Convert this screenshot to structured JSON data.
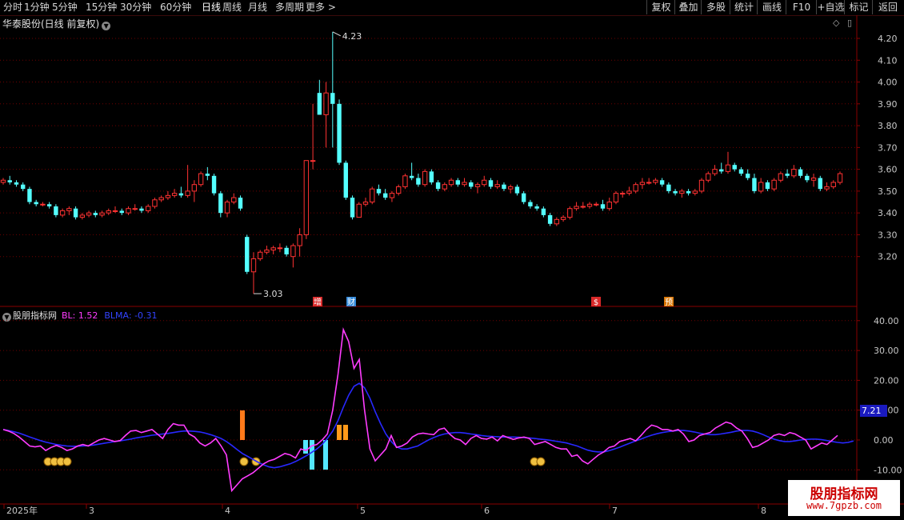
{
  "toolbar": {
    "periods": [
      "分时",
      "1分钟",
      "5分钟",
      "15分钟",
      "30分钟",
      "60分钟",
      "日线",
      "周线",
      "月线",
      "多周期",
      "更多 >"
    ],
    "active_period": "日线",
    "right_buttons": [
      "复权",
      "叠加",
      "多股",
      "统计",
      "画线",
      "F10",
      "+自选",
      "标记",
      "返回"
    ]
  },
  "stock_title": "华泰股份(日线 前复权)",
  "indicator": {
    "name": "股朋指标网",
    "bl_label": "BL: 1.52",
    "blma_label": "BLMA: -0.31"
  },
  "price_axis": [
    "4.20",
    "4.10",
    "4.00",
    "3.90",
    "3.80",
    "3.70",
    "3.60",
    "3.50",
    "3.40",
    "3.30",
    "3.20"
  ],
  "ind_axis": [
    "40.00",
    "30.00",
    "20.00",
    "10.00",
    "0.00",
    "-10.00"
  ],
  "ind_current_value": "7.21",
  "annotations": {
    "high": "4.23",
    "low": "3.03"
  },
  "event_markers": [
    {
      "label": "增",
      "color": "#ff3030"
    },
    {
      "label": "财",
      "color": "#3aa0ff"
    },
    {
      "label": "$",
      "color": "#ff3030"
    },
    {
      "label": "预",
      "color": "#ff8800"
    }
  ],
  "date_axis": [
    "2025年",
    "3",
    "4",
    "5",
    "6",
    "7",
    "8"
  ],
  "watermark": {
    "title": "股朋指标网",
    "url": "www.7gpzb.com"
  },
  "colors": {
    "up": "#ff3232",
    "down": "#54ffff",
    "bl": "#ff3cff",
    "blma": "#2828ff",
    "grid": "#6e0000",
    "axis": "#8a0000"
  },
  "chart_data": [
    {
      "type": "candlestick",
      "title": "华泰股份(日线 前复权)",
      "ylim": [
        3.03,
        4.23
      ],
      "series_note": "daily OHLC",
      "ohlc": [
        [
          3.54,
          3.56,
          3.53,
          3.55
        ],
        [
          3.55,
          3.57,
          3.53,
          3.54
        ],
        [
          3.54,
          3.55,
          3.52,
          3.53
        ],
        [
          3.53,
          3.54,
          3.5,
          3.51
        ],
        [
          3.51,
          3.52,
          3.44,
          3.45
        ],
        [
          3.45,
          3.46,
          3.43,
          3.44
        ],
        [
          3.44,
          3.45,
          3.43,
          3.44
        ],
        [
          3.44,
          3.45,
          3.42,
          3.43
        ],
        [
          3.43,
          3.44,
          3.38,
          3.39
        ],
        [
          3.39,
          3.42,
          3.38,
          3.41
        ],
        [
          3.41,
          3.43,
          3.39,
          3.42
        ],
        [
          3.42,
          3.43,
          3.37,
          3.38
        ],
        [
          3.38,
          3.4,
          3.37,
          3.39
        ],
        [
          3.39,
          3.41,
          3.38,
          3.4
        ],
        [
          3.4,
          3.41,
          3.38,
          3.39
        ],
        [
          3.39,
          3.41,
          3.38,
          3.4
        ],
        [
          3.4,
          3.42,
          3.39,
          3.41
        ],
        [
          3.41,
          3.43,
          3.4,
          3.41
        ],
        [
          3.41,
          3.42,
          3.39,
          3.4
        ],
        [
          3.4,
          3.43,
          3.39,
          3.42
        ],
        [
          3.42,
          3.44,
          3.41,
          3.42
        ],
        [
          3.42,
          3.43,
          3.4,
          3.41
        ],
        [
          3.41,
          3.44,
          3.4,
          3.43
        ],
        [
          3.43,
          3.47,
          3.42,
          3.46
        ],
        [
          3.46,
          3.48,
          3.45,
          3.47
        ],
        [
          3.47,
          3.5,
          3.46,
          3.48
        ],
        [
          3.48,
          3.51,
          3.47,
          3.49
        ],
        [
          3.49,
          3.52,
          3.47,
          3.48
        ],
        [
          3.48,
          3.62,
          3.47,
          3.5
        ],
        [
          3.5,
          3.55,
          3.45,
          3.53
        ],
        [
          3.53,
          3.59,
          3.52,
          3.58
        ],
        [
          3.58,
          3.61,
          3.55,
          3.57
        ],
        [
          3.57,
          3.58,
          3.48,
          3.49
        ],
        [
          3.49,
          3.5,
          3.38,
          3.4
        ],
        [
          3.4,
          3.46,
          3.38,
          3.45
        ],
        [
          3.45,
          3.49,
          3.44,
          3.47
        ],
        [
          3.47,
          3.48,
          3.41,
          3.42
        ],
        [
          3.29,
          3.3,
          3.12,
          3.13
        ],
        [
          3.13,
          3.22,
          3.03,
          3.19
        ],
        [
          3.19,
          3.23,
          3.18,
          3.22
        ],
        [
          3.22,
          3.25,
          3.21,
          3.23
        ],
        [
          3.23,
          3.25,
          3.21,
          3.24
        ],
        [
          3.24,
          3.26,
          3.22,
          3.24
        ],
        [
          3.24,
          3.25,
          3.2,
          3.21
        ],
        [
          3.2,
          3.26,
          3.15,
          3.25
        ],
        [
          3.25,
          3.33,
          3.2,
          3.3
        ],
        [
          3.3,
          3.4,
          3.28,
          3.64
        ],
        [
          3.64,
          3.9,
          3.6,
          3.64
        ],
        [
          3.95,
          4.01,
          3.85,
          3.85
        ],
        [
          3.85,
          4.0,
          3.7,
          3.95
        ],
        [
          3.95,
          4.23,
          3.7,
          3.9
        ],
        [
          3.9,
          3.92,
          3.62,
          3.63
        ],
        [
          3.63,
          3.64,
          3.46,
          3.47
        ],
        [
          3.47,
          3.48,
          3.37,
          3.38
        ],
        [
          3.38,
          3.45,
          3.38,
          3.44
        ],
        [
          3.44,
          3.47,
          3.43,
          3.45
        ],
        [
          3.45,
          3.52,
          3.44,
          3.51
        ],
        [
          3.51,
          3.53,
          3.48,
          3.49
        ],
        [
          3.49,
          3.51,
          3.46,
          3.47
        ],
        [
          3.47,
          3.5,
          3.45,
          3.49
        ],
        [
          3.49,
          3.53,
          3.48,
          3.52
        ],
        [
          3.52,
          3.58,
          3.51,
          3.57
        ],
        [
          3.57,
          3.63,
          3.55,
          3.56
        ],
        [
          3.56,
          3.58,
          3.52,
          3.53
        ],
        [
          3.53,
          3.6,
          3.52,
          3.59
        ],
        [
          3.59,
          3.6,
          3.53,
          3.54
        ],
        [
          3.54,
          3.55,
          3.5,
          3.51
        ],
        [
          3.51,
          3.54,
          3.5,
          3.53
        ],
        [
          3.53,
          3.56,
          3.52,
          3.55
        ],
        [
          3.55,
          3.56,
          3.52,
          3.53
        ],
        [
          3.53,
          3.56,
          3.52,
          3.54
        ],
        [
          3.54,
          3.55,
          3.51,
          3.52
        ],
        [
          3.52,
          3.54,
          3.49,
          3.53
        ],
        [
          3.53,
          3.57,
          3.52,
          3.55
        ],
        [
          3.55,
          3.56,
          3.51,
          3.52
        ],
        [
          3.52,
          3.55,
          3.51,
          3.53
        ],
        [
          3.53,
          3.54,
          3.5,
          3.51
        ],
        [
          3.51,
          3.53,
          3.49,
          3.52
        ],
        [
          3.52,
          3.53,
          3.48,
          3.49
        ],
        [
          3.49,
          3.5,
          3.44,
          3.45
        ],
        [
          3.45,
          3.46,
          3.42,
          3.43
        ],
        [
          3.43,
          3.44,
          3.41,
          3.42
        ],
        [
          3.42,
          3.43,
          3.38,
          3.39
        ],
        [
          3.39,
          3.4,
          3.34,
          3.35
        ],
        [
          3.35,
          3.38,
          3.34,
          3.37
        ],
        [
          3.37,
          3.39,
          3.36,
          3.38
        ],
        [
          3.38,
          3.43,
          3.37,
          3.42
        ],
        [
          3.42,
          3.45,
          3.41,
          3.43
        ],
        [
          3.43,
          3.45,
          3.42,
          3.43
        ],
        [
          3.43,
          3.45,
          3.42,
          3.44
        ],
        [
          3.44,
          3.45,
          3.43,
          3.44
        ],
        [
          3.44,
          3.46,
          3.41,
          3.42
        ],
        [
          3.42,
          3.47,
          3.41,
          3.45
        ],
        [
          3.45,
          3.5,
          3.44,
          3.49
        ],
        [
          3.49,
          3.5,
          3.47,
          3.49
        ],
        [
          3.49,
          3.52,
          3.48,
          3.5
        ],
        [
          3.5,
          3.54,
          3.49,
          3.53
        ],
        [
          3.53,
          3.56,
          3.51,
          3.54
        ],
        [
          3.54,
          3.56,
          3.53,
          3.54
        ],
        [
          3.54,
          3.56,
          3.53,
          3.55
        ],
        [
          3.55,
          3.56,
          3.52,
          3.53
        ],
        [
          3.53,
          3.54,
          3.49,
          3.5
        ],
        [
          3.5,
          3.51,
          3.48,
          3.49
        ],
        [
          3.49,
          3.51,
          3.47,
          3.5
        ],
        [
          3.5,
          3.51,
          3.48,
          3.49
        ],
        [
          3.49,
          3.51,
          3.48,
          3.5
        ],
        [
          3.5,
          3.56,
          3.49,
          3.55
        ],
        [
          3.55,
          3.59,
          3.54,
          3.58
        ],
        [
          3.58,
          3.62,
          3.57,
          3.6
        ],
        [
          3.6,
          3.63,
          3.58,
          3.59
        ],
        [
          3.59,
          3.68,
          3.58,
          3.62
        ],
        [
          3.62,
          3.63,
          3.59,
          3.6
        ],
        [
          3.6,
          3.61,
          3.57,
          3.58
        ],
        [
          3.58,
          3.6,
          3.55,
          3.56
        ],
        [
          3.56,
          3.58,
          3.49,
          3.5
        ],
        [
          3.5,
          3.56,
          3.49,
          3.54
        ],
        [
          3.54,
          3.55,
          3.5,
          3.51
        ],
        [
          3.51,
          3.56,
          3.5,
          3.55
        ],
        [
          3.55,
          3.59,
          3.54,
          3.58
        ],
        [
          3.58,
          3.6,
          3.56,
          3.57
        ],
        [
          3.57,
          3.62,
          3.56,
          3.6
        ],
        [
          3.6,
          3.61,
          3.56,
          3.57
        ],
        [
          3.57,
          3.58,
          3.54,
          3.55
        ],
        [
          3.55,
          3.58,
          3.52,
          3.56
        ],
        [
          3.56,
          3.57,
          3.5,
          3.51
        ],
        [
          3.51,
          3.54,
          3.5,
          3.52
        ],
        [
          3.52,
          3.55,
          3.51,
          3.54
        ],
        [
          3.54,
          3.59,
          3.53,
          3.58
        ]
      ]
    },
    {
      "type": "line",
      "title": "股朋指标网",
      "ylim": [
        -10,
        40
      ],
      "series": [
        {
          "name": "BL",
          "values": [
            3.5,
            3.0,
            2.2,
            1.0,
            -0.5,
            -2.0,
            -2.3,
            -2.0,
            -3.5,
            -2.5,
            -1.8,
            -2.5,
            -3.5,
            -3.0,
            -2.0,
            -1.5,
            -2.0,
            -1.0,
            0.0,
            0.5,
            0.0,
            -0.5,
            -0.2,
            1.5,
            3.0,
            3.2,
            2.5,
            3.0,
            3.5,
            2.0,
            0.5,
            3.5,
            5.5,
            5.0,
            5.0,
            2.0,
            1.0,
            -1.0,
            -2.0,
            -1.0,
            0.5,
            -2.0,
            -5.0,
            -17.0,
            -15.0,
            -13.0,
            -12.0,
            -11.0,
            -9.5,
            -8.0,
            -7.0,
            -6.5,
            -5.5,
            -4.5,
            -5.0,
            -6.0,
            -3.0,
            -3.5,
            -2.0,
            -1.5,
            0.0,
            2.0,
            10.0,
            22.0,
            37.0,
            33.0,
            24.0,
            27.0,
            10.0,
            -3.0,
            -7.0,
            -5.0,
            -3.0,
            1.5,
            -2.5,
            -2.0,
            -1.0,
            1.0,
            2.0,
            2.3,
            2.0,
            1.8,
            3.5,
            4.0,
            2.0,
            0.5,
            0.0,
            -1.5,
            0.5,
            1.5,
            0.5,
            0.3,
            1.0,
            -0.3,
            1.5,
            0.8,
            0.2,
            0.7,
            1.0,
            0.5,
            -1.5,
            -1.0,
            -0.5,
            -1.5,
            -2.5,
            -3.0,
            -3.0,
            -5.5,
            -5.0,
            -7.0,
            -8.0,
            -6.5,
            -5.0,
            -4.0,
            -2.5,
            -2.0,
            -0.5,
            0.0,
            0.5,
            -0.3,
            1.5,
            3.5,
            5.0,
            4.5,
            3.5,
            3.5,
            3.0,
            3.5,
            2.0,
            -0.5,
            0.0,
            1.5,
            2.0,
            2.5,
            4.0,
            5.0,
            6.0,
            5.5,
            4.0,
            3.0,
            0.5,
            -2.5,
            -2.0,
            -1.0,
            0.0,
            1.5,
            2.0,
            1.5,
            2.5,
            2.0,
            1.0,
            0.0,
            -3.0,
            -2.0,
            -1.0,
            -1.5,
            0.0,
            1.52
          ]
        },
        {
          "name": "BLMA",
          "values": [
            3.5,
            3.2,
            2.8,
            2.3,
            1.7,
            1.0,
            0.4,
            -0.2,
            -0.7,
            -1.1,
            -1.5,
            -1.8,
            -2.0,
            -2.1,
            -2.1,
            -2.0,
            -1.9,
            -1.7,
            -1.4,
            -1.1,
            -0.8,
            -0.5,
            -0.3,
            0.0,
            0.3,
            0.7,
            1.0,
            1.3,
            1.6,
            1.8,
            2.0,
            2.2,
            2.5,
            2.8,
            3.0,
            3.0,
            2.9,
            2.7,
            2.3,
            1.8,
            1.2,
            0.5,
            -0.5,
            -1.8,
            -3.2,
            -4.5,
            -5.5,
            -6.5,
            -7.5,
            -8.3,
            -9.0,
            -9.3,
            -9.0,
            -8.5,
            -8.0,
            -7.2,
            -6.3,
            -5.3,
            -4.2,
            -3.0,
            -1.5,
            0.5,
            3.0,
            6.5,
            11.0,
            15.0,
            18.0,
            19.0,
            17.5,
            14.0,
            9.5,
            5.5,
            2.0,
            -0.5,
            -2.3,
            -3.0,
            -3.0,
            -2.5,
            -2.0,
            -1.0,
            0.0,
            0.8,
            1.5,
            2.0,
            2.3,
            2.5,
            2.5,
            2.3,
            2.0,
            1.8,
            1.5,
            1.3,
            1.2,
            1.1,
            1.0,
            1.0,
            1.0,
            0.9,
            0.8,
            0.7,
            0.5,
            0.3,
            0.1,
            -0.1,
            -0.4,
            -0.7,
            -1.0,
            -1.5,
            -2.0,
            -2.7,
            -3.4,
            -3.8,
            -4.0,
            -4.0,
            -3.6,
            -3.0,
            -2.4,
            -1.7,
            -1.0,
            -0.3,
            0.3,
            1.0,
            1.6,
            2.1,
            2.5,
            2.8,
            3.0,
            3.2,
            3.2,
            3.0,
            2.7,
            2.3,
            2.0,
            1.8,
            1.8,
            2.0,
            2.3,
            2.6,
            3.0,
            3.2,
            3.2,
            3.0,
            2.5,
            1.8,
            1.0,
            0.3,
            -0.2,
            -0.5,
            -0.5,
            -0.3,
            0.0,
            0.2,
            0.3,
            0.3,
            0.1,
            -0.2,
            -0.5,
            -0.8,
            -1.0,
            -0.8,
            -0.31
          ]
        }
      ]
    }
  ]
}
